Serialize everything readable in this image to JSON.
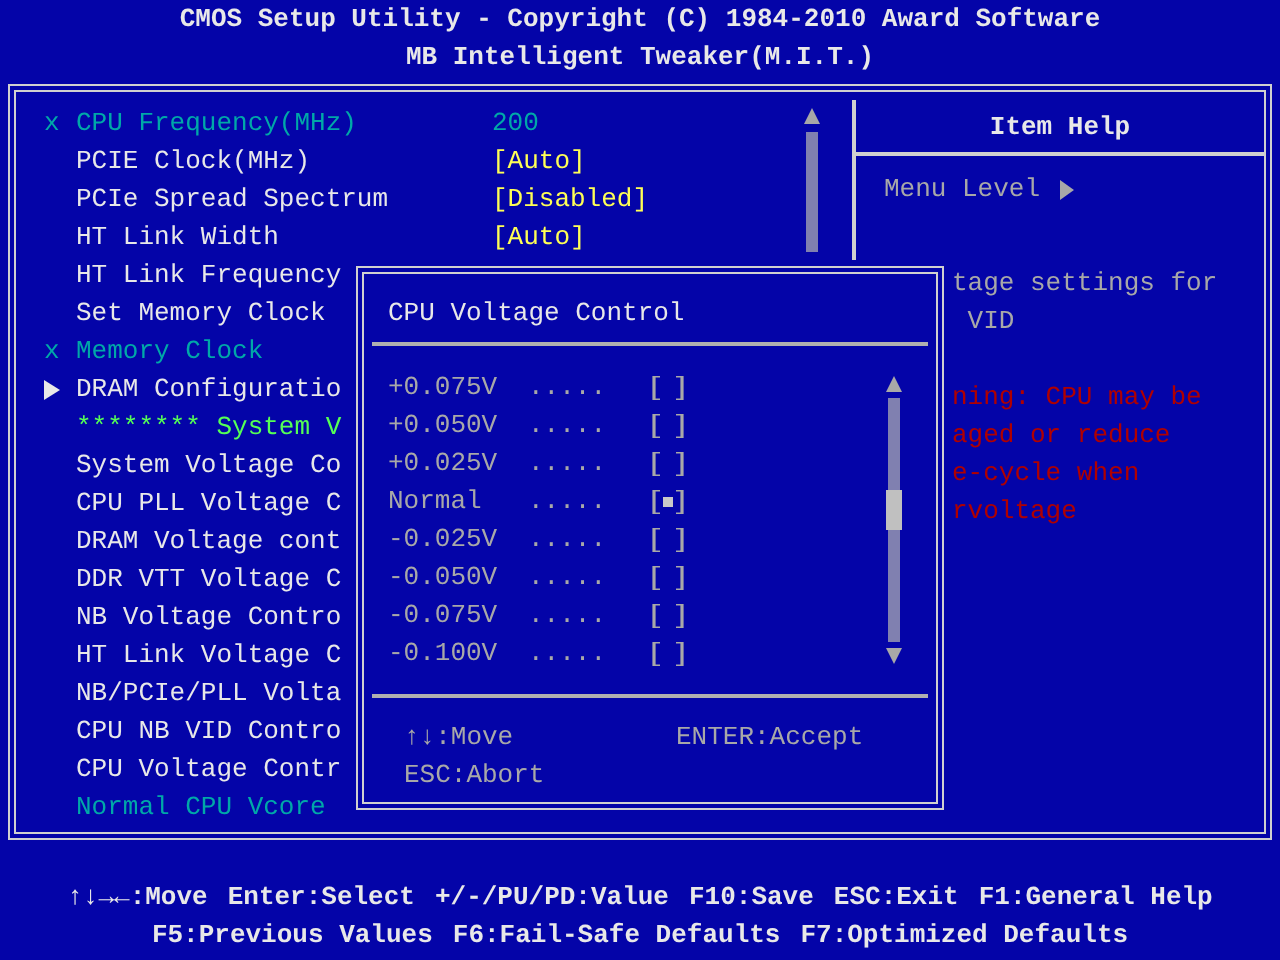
{
  "header": {
    "title": "CMOS Setup Utility - Copyright (C) 1984-2010 Award Software",
    "subtitle": "MB Intelligent Tweaker(M.I.T.)"
  },
  "settings": [
    {
      "kind": "locked",
      "marker": "x",
      "label": "CPU Frequency(MHz)",
      "value": "200"
    },
    {
      "kind": "option",
      "label": "PCIE Clock(MHz)",
      "value": "[Auto]"
    },
    {
      "kind": "option",
      "label": "PCIe Spread Spectrum",
      "value": "[Disabled]"
    },
    {
      "kind": "option",
      "label": "HT Link Width",
      "value": "[Auto]"
    },
    {
      "kind": "option",
      "label": "HT Link Frequency"
    },
    {
      "kind": "option",
      "label": "Set Memory Clock"
    },
    {
      "kind": "locked",
      "marker": "x",
      "label": "Memory Clock"
    },
    {
      "kind": "submenu",
      "label": "DRAM Configuratio"
    },
    {
      "kind": "section",
      "label": "******** System V"
    },
    {
      "kind": "option",
      "label": "System Voltage Co"
    },
    {
      "kind": "option",
      "label": "CPU PLL Voltage C"
    },
    {
      "kind": "option",
      "label": "DRAM Voltage cont"
    },
    {
      "kind": "option",
      "label": "DDR VTT Voltage C"
    },
    {
      "kind": "option",
      "label": "NB Voltage Contro"
    },
    {
      "kind": "option",
      "label": "HT Link Voltage C"
    },
    {
      "kind": "option",
      "label": "NB/PCIe/PLL Volta"
    },
    {
      "kind": "option",
      "label": "CPU NB VID Contro"
    },
    {
      "kind": "option",
      "label": "CPU Voltage Contr"
    },
    {
      "kind": "note",
      "label": "Normal CPU Vcore"
    }
  ],
  "help": {
    "title": "Item Help",
    "menu_level": "Menu Level",
    "lines": [
      {
        "kind": "info",
        "text": "tage settings for"
      },
      {
        "kind": "info",
        "text": " VID"
      },
      {
        "kind": "warning",
        "text": "ning: CPU may be"
      },
      {
        "kind": "warning",
        "text": "aged or reduce"
      },
      {
        "kind": "warning",
        "text": "e-cycle when"
      },
      {
        "kind": "warning",
        "text": "rvoltage"
      }
    ]
  },
  "popup": {
    "title": "CPU Voltage Control",
    "options": [
      {
        "label": "+0.075V",
        "leader": ".....",
        "selected": false
      },
      {
        "label": "+0.050V",
        "leader": ".....",
        "selected": false
      },
      {
        "label": "+0.025V",
        "leader": ".....",
        "selected": false
      },
      {
        "label": "Normal",
        "leader": ".....",
        "selected": true
      },
      {
        "label": "-0.025V",
        "leader": ".....",
        "selected": false
      },
      {
        "label": "-0.050V",
        "leader": ".....",
        "selected": false
      },
      {
        "label": "-0.075V",
        "leader": ".....",
        "selected": false
      },
      {
        "label": "-0.100V",
        "leader": ".....",
        "selected": false
      }
    ],
    "keys": [
      "↑↓:Move",
      "ENTER:Accept",
      "ESC:Abort"
    ]
  },
  "footer": {
    "line_1": [
      "↑↓→←:Move",
      "Enter:Select",
      "+/-/PU/PD:Value",
      "F10:Save",
      "ESC:Exit",
      "F1:General Help"
    ],
    "line_2": [
      "F5:Previous Values",
      "F6:Fail-Safe Defaults",
      "F7:Optimized Defaults"
    ]
  }
}
